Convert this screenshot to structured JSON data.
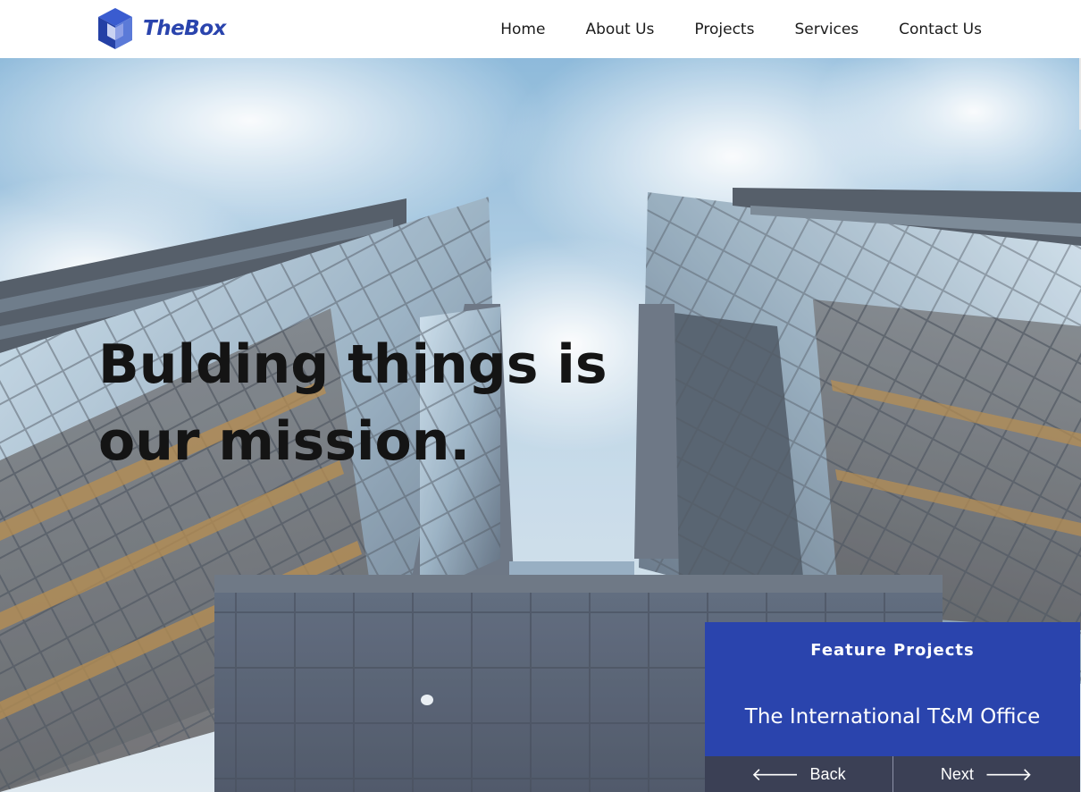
{
  "header": {
    "logo_text": "TheBox",
    "nav": [
      "Home",
      "About Us",
      "Projects",
      "Services",
      "Contact Us"
    ]
  },
  "hero": {
    "title_line1": "Bulding things is",
    "title_line2": "our mission."
  },
  "feature": {
    "heading": "Feature Projects",
    "project_name": "The International T&M Office",
    "back_label": "Back",
    "next_label": "Next"
  },
  "colors": {
    "brand": "#2a44ad",
    "feature_nav_bg": "#3b4055",
    "title_text": "#141414"
  },
  "icons": {
    "logo": "cube-logo-icon",
    "back": "arrow-left-icon",
    "next": "arrow-right-icon"
  }
}
